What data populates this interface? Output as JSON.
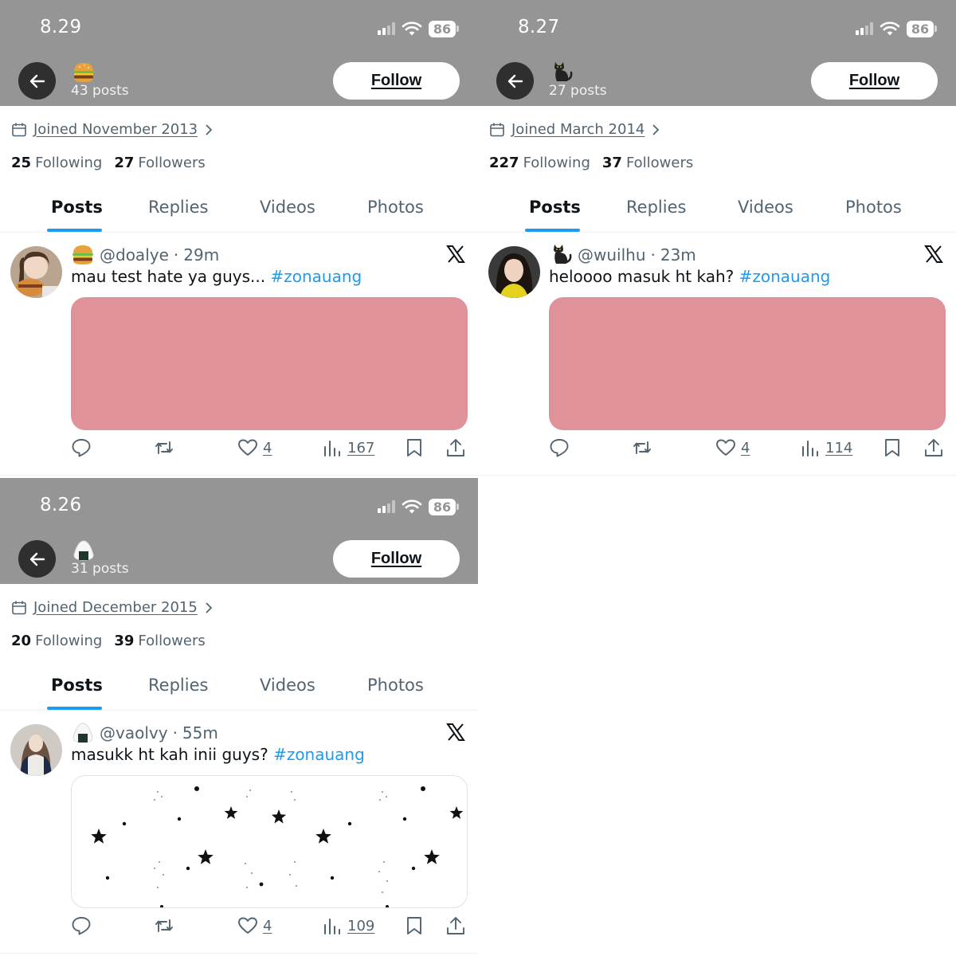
{
  "colors": {
    "accent": "#1d9bf0",
    "header_bg": "#959595",
    "media_pink": "#e0929a",
    "text_muted": "#536471"
  },
  "tab_labels": [
    "Posts",
    "Replies",
    "Videos",
    "Photos"
  ],
  "panels": [
    {
      "status": {
        "time": "8.29",
        "battery": "86"
      },
      "header": {
        "avatar_icon": "burger-emoji-icon",
        "posts_count": "43 posts",
        "follow_label": "Follow"
      },
      "joined": "Joined November 2013",
      "following_num": "25",
      "following_label": "Following",
      "followers_num": "27",
      "followers_label": "Followers",
      "post": {
        "name_icon": "burger-emoji-icon",
        "handle": "@doalye",
        "sep": "·",
        "time": "29m",
        "text": "mau test hate ya guys... ",
        "hashtag": "#zonauang",
        "media": "pink-block",
        "likes": "4",
        "views": "167"
      }
    },
    {
      "status": {
        "time": "8.27",
        "battery": "86"
      },
      "header": {
        "avatar_icon": "black-cat-emoji-icon",
        "posts_count": "27 posts",
        "follow_label": "Follow"
      },
      "joined": "Joined March 2014",
      "following_num": "227",
      "following_label": "Following",
      "followers_num": "37",
      "followers_label": "Followers",
      "post": {
        "name_icon": "black-cat-emoji-icon",
        "handle": "@wuilhu",
        "sep": "·",
        "time": "23m",
        "text": "heloooo masuk ht kah? ",
        "hashtag": "#zonauang",
        "media": "pink-block",
        "likes": "4",
        "views": "114"
      }
    },
    {
      "status": {
        "time": "8.26",
        "battery": "86"
      },
      "header": {
        "avatar_icon": "rice-ball-emoji-icon",
        "posts_count": "31 posts",
        "follow_label": "Follow"
      },
      "joined": "Joined December 2015",
      "following_num": "20",
      "following_label": "Following",
      "followers_num": "39",
      "followers_label": "Followers",
      "post": {
        "name_icon": "rice-ball-emoji-icon",
        "handle": "@vaolvy",
        "sep": "·",
        "time": "55m",
        "text": "masukk ht kah inii guys? ",
        "hashtag": "#zonauang",
        "media": "stars-pattern",
        "likes": "4",
        "views": "109"
      }
    }
  ]
}
